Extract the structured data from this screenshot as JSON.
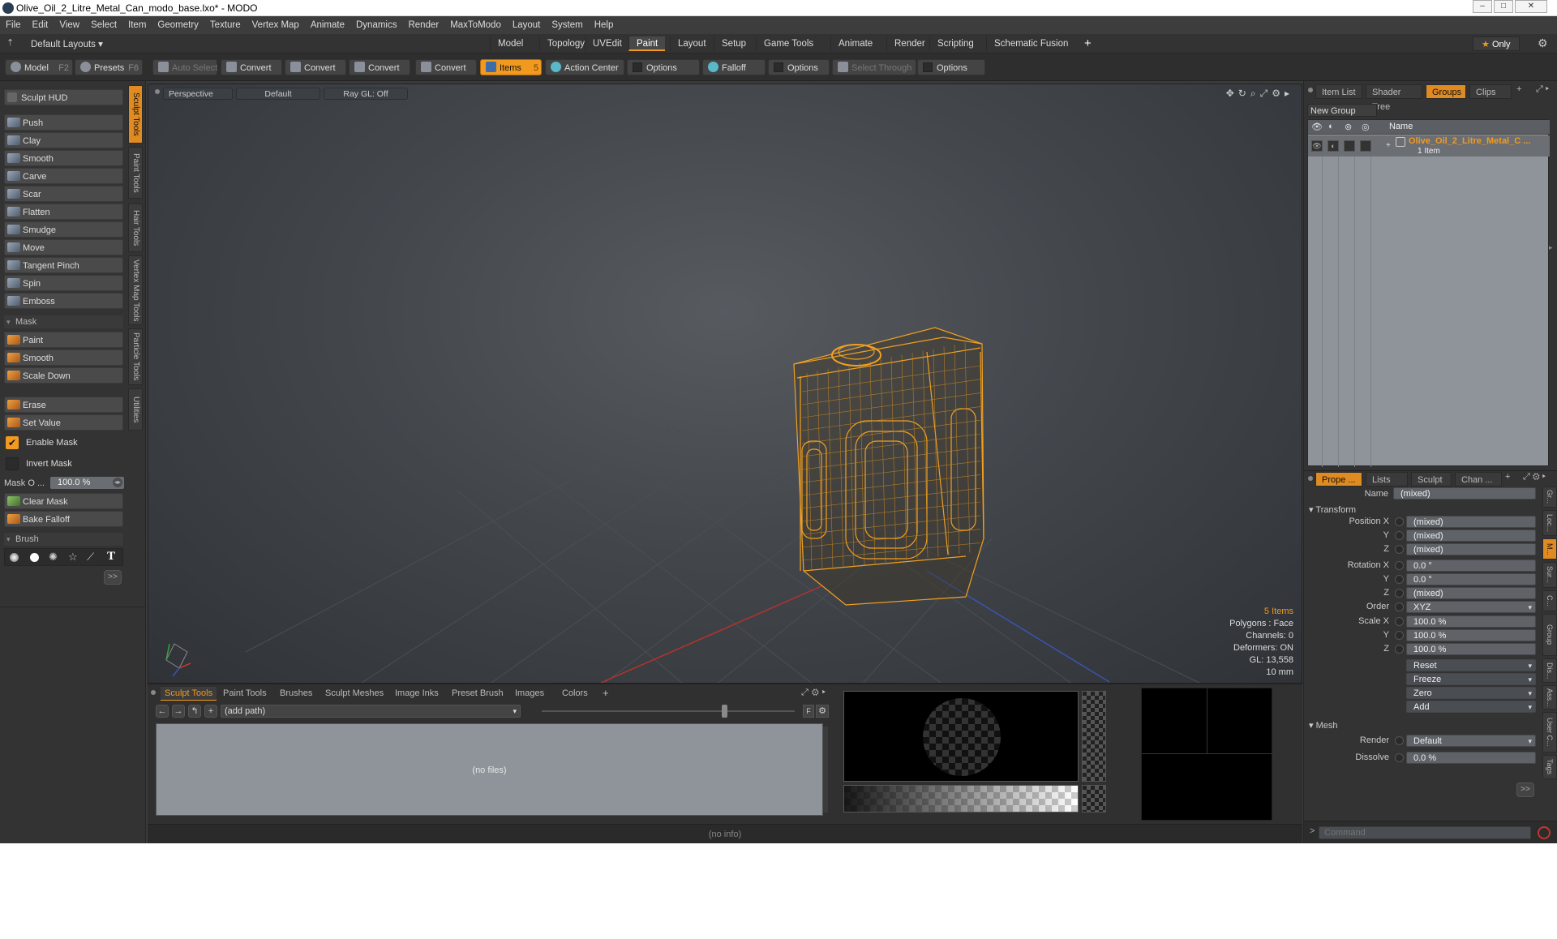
{
  "window": {
    "title": "Olive_Oil_2_Litre_Metal_Can_modo_base.lxo* - MODO"
  },
  "menu": [
    "File",
    "Edit",
    "View",
    "Select",
    "Item",
    "Geometry",
    "Texture",
    "Vertex Map",
    "Animate",
    "Dynamics",
    "Render",
    "MaxToModo",
    "Layout",
    "System",
    "Help"
  ],
  "layouts": {
    "selector": "Default Layouts",
    "tabs": [
      "Model",
      "Topology",
      "UVEdit",
      "Paint",
      "Layout",
      "Setup",
      "Game Tools",
      "Animate",
      "Render",
      "Scripting",
      "Schematic Fusion"
    ],
    "active": "Paint",
    "plus": "+",
    "only": "Only"
  },
  "toolbar": {
    "model": "Model",
    "model_key": "F2",
    "presets": "Presets",
    "presets_key": "F6",
    "auto_select": "Auto Select",
    "convert1": "Convert",
    "convert2": "Convert",
    "convert3": "Convert",
    "convert4": "Convert",
    "items": "Items",
    "items_key": "5",
    "action_center": "Action Center",
    "options1": "Options",
    "falloff": "Falloff",
    "options2": "Options",
    "select_through": "Select Through",
    "options3": "Options"
  },
  "sculpt": {
    "hud": "Sculpt HUD",
    "tools": [
      "Push",
      "Clay",
      "Smooth",
      "Carve",
      "Scar",
      "Flatten",
      "Smudge",
      "Move",
      "Tangent Pinch",
      "Spin",
      "Emboss"
    ],
    "mask_header": "Mask",
    "mask_tools": [
      "Paint",
      "Smooth",
      "Scale Down"
    ],
    "erase": "Erase",
    "set_value": "Set Value",
    "enable_mask": "Enable Mask",
    "invert_mask": "Invert Mask",
    "mask_opacity_label": "Mask O ...",
    "mask_opacity": "100.0 %",
    "clear_mask": "Clear Mask",
    "bake_falloff": "Bake Falloff",
    "brush_header": "Brush",
    "more": ">>"
  },
  "side_tabs": [
    "Sculpt Tools",
    "Paint Tools",
    "Hair Tools",
    "Vertex Map Tools",
    "Particle Tools",
    "Utilities"
  ],
  "viewport": {
    "view": "Perspective",
    "shading": "Default",
    "raygl": "Ray GL: Off",
    "stats": {
      "items": "5 Items",
      "polygons": "Polygons : Face",
      "channels": "Channels: 0",
      "deformers": "Deformers: ON",
      "gl": "GL: 13,558",
      "scale": "10 mm"
    }
  },
  "bottom": {
    "tabs": [
      "Sculpt Tools",
      "Paint Tools",
      "Brushes",
      "Sculpt Meshes",
      "Image Inks",
      "Preset Brush",
      "Images",
      "Colors"
    ],
    "plus": "+",
    "path": "(add path)",
    "empty": "(no files)",
    "info": "(no info)"
  },
  "right_top": {
    "tabs": [
      "Item List",
      "Shader Tree",
      "Groups",
      "Clips"
    ],
    "active": "Groups",
    "plus": "+",
    "new_group": "New Group",
    "col_name": "Name",
    "group_name": "Olive_Oil_2_Litre_Metal_C ...",
    "group_count": "1 Item"
  },
  "properties": {
    "tabs": [
      "Prope ...",
      "Lists",
      "Sculpt",
      "Chan ..."
    ],
    "plus": "+",
    "name_label": "Name",
    "name_value": "(mixed)",
    "transform": "Transform",
    "position_x_label": "Position X",
    "position_x": "(mixed)",
    "position_y_label": "Y",
    "position_y": "(mixed)",
    "position_z_label": "Z",
    "position_z": "(mixed)",
    "rotation_x_label": "Rotation X",
    "rotation_x": "0.0 °",
    "rotation_y_label": "Y",
    "rotation_y": "0.0 °",
    "rotation_z_label": "Z",
    "rotation_z": "(mixed)",
    "order_label": "Order",
    "order": "XYZ",
    "scale_x_label": "Scale X",
    "scale_x": "100.0 %",
    "scale_y_label": "Y",
    "scale_y": "100.0 %",
    "scale_z_label": "Z",
    "scale_z": "100.0 %",
    "reset": "Reset",
    "freeze": "Freeze",
    "zero": "Zero",
    "add": "Add",
    "mesh": "Mesh",
    "render_label": "Render",
    "render": "Default",
    "dissolve_label": "Dissolve",
    "dissolve": "0.0 %",
    "more": ">>",
    "side_tabs": [
      "Gr...",
      "Loc...",
      "M...",
      "Sur...",
      "C...",
      "Group",
      "Dis...",
      "Ass...",
      "User C...",
      "Tags"
    ]
  },
  "command": {
    "prompt": ">",
    "placeholder": "Command"
  },
  "colors": {
    "accent": "#f19a1f",
    "wire": "#f2a020"
  }
}
